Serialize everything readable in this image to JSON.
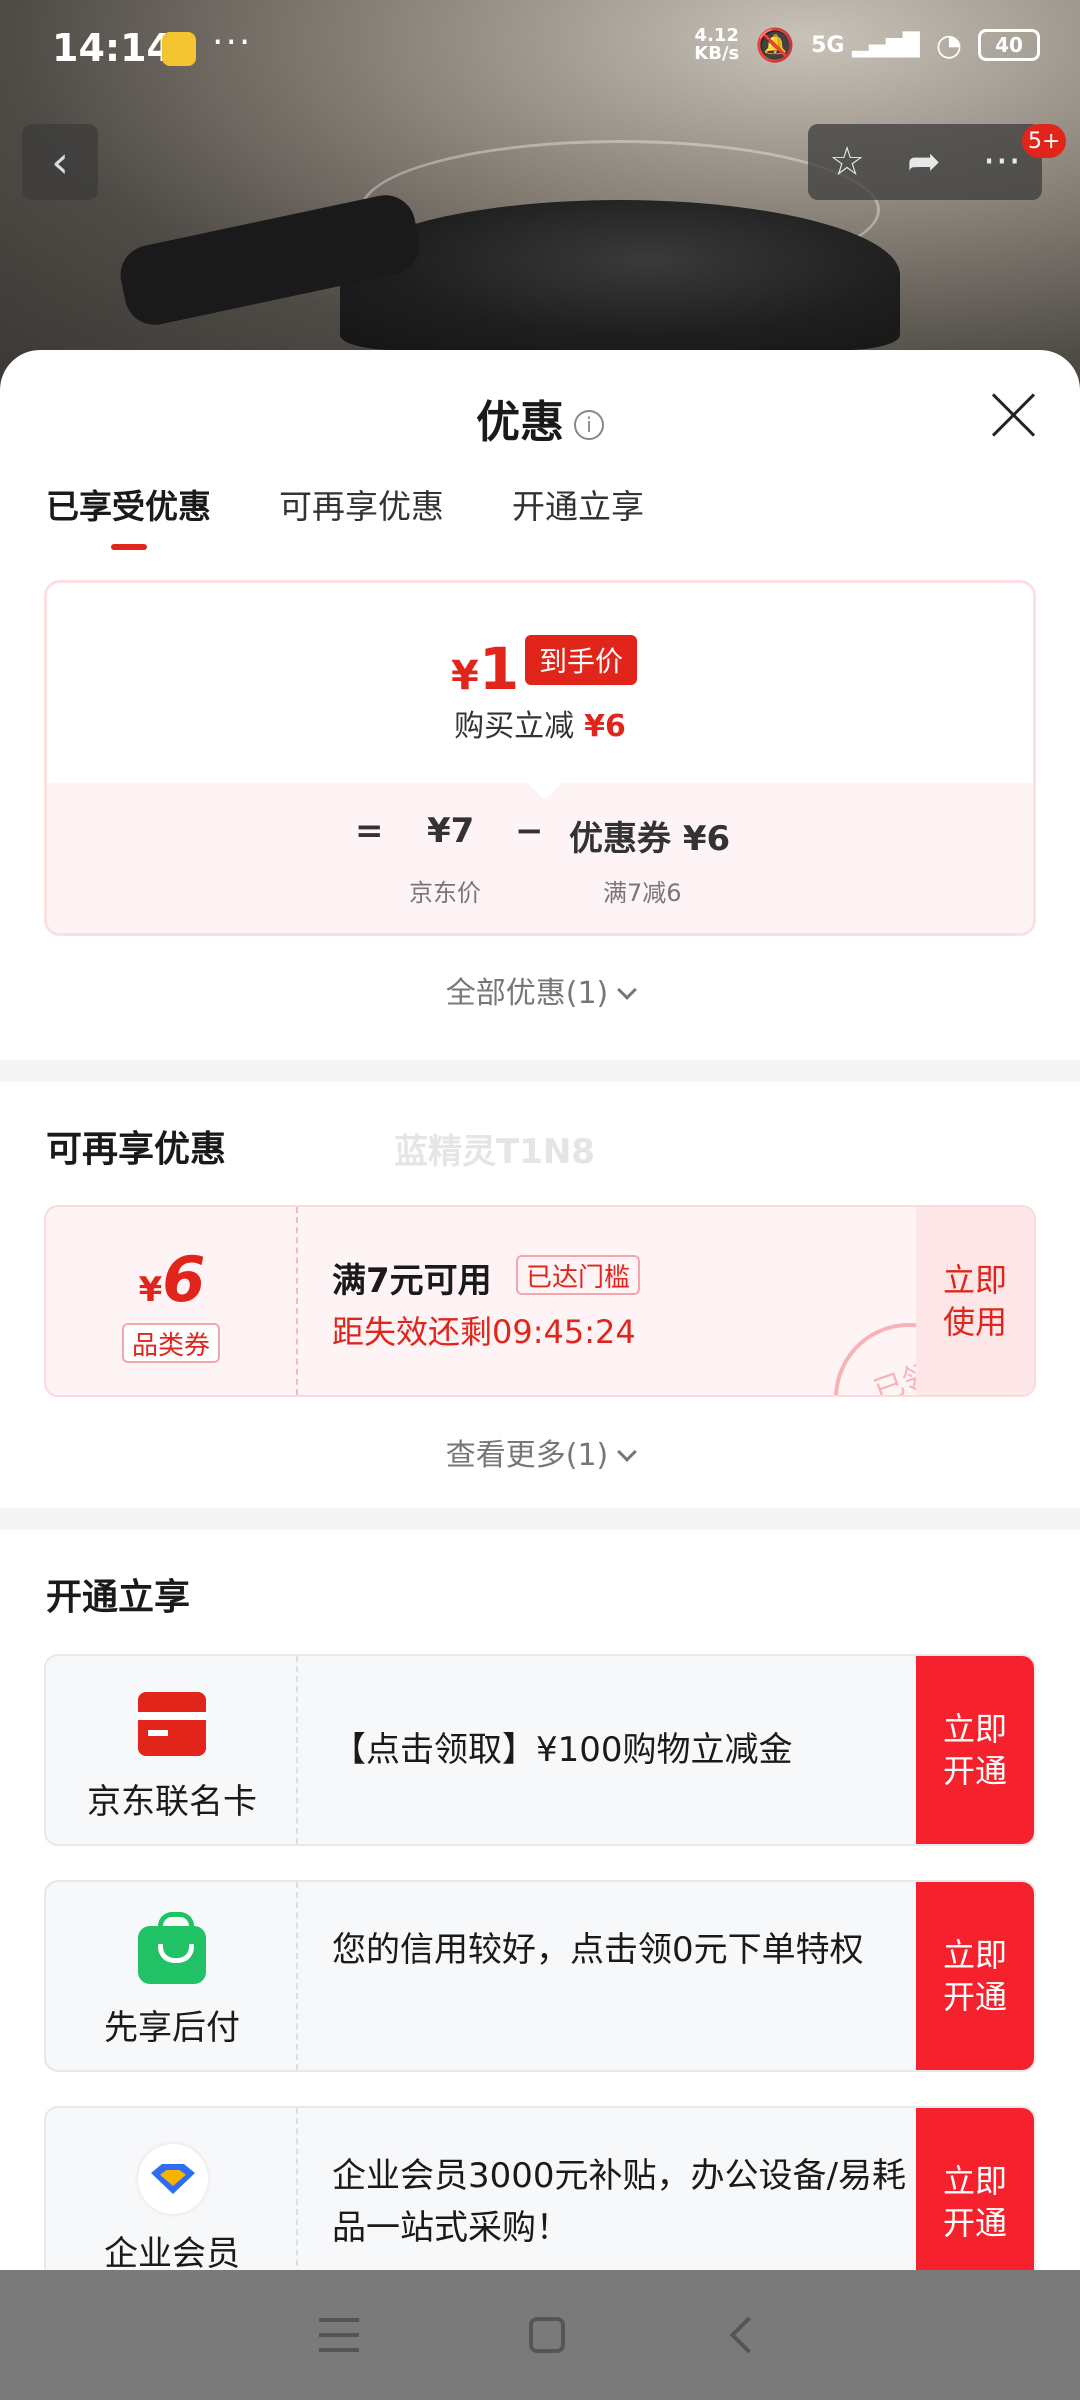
{
  "status_bar": {
    "time": "14:14",
    "net_speed_top": "4.12",
    "net_speed_bottom": "KB/s",
    "signal_label": "5G",
    "battery": "40"
  },
  "nav": {
    "badge": "5+"
  },
  "sheet": {
    "title": "优惠",
    "info_icon": "i",
    "tabs": [
      "已享受优惠",
      "可再享优惠",
      "开通立享"
    ],
    "price": {
      "currency": "¥",
      "final": "1",
      "tag": "到手价",
      "reduce_label": "购买立减",
      "reduce_value": "¥6",
      "eq": "=",
      "jd_price": "¥7",
      "minus": "−",
      "coupon_label": "优惠券 ¥6",
      "jd_price_caption": "京东价",
      "coupon_caption": "满7减6"
    },
    "all_offers": "全部优惠(1)"
  },
  "reenjoy": {
    "title": "可再享优惠",
    "watermark": "蓝精灵T1N8",
    "coupon": {
      "currency": "¥",
      "amount": "6",
      "type": "品类券",
      "condition": "满7元可用",
      "condition_tag": "已达门槛",
      "countdown": "距失效还剩09:45:24",
      "action_line1": "立即",
      "action_line2": "使用",
      "stamp": "已领"
    },
    "see_more": "查看更多(1)"
  },
  "open": {
    "title": "开通立享",
    "items": [
      {
        "name": "京东联名卡",
        "desc": "【点击领取】¥100购物立减金",
        "btn1": "立即",
        "btn2": "开通"
      },
      {
        "name": "先享后付",
        "desc": "您的信用较好，点击领0元下单特权",
        "btn1": "立即",
        "btn2": "开通"
      },
      {
        "name": "企业会员",
        "desc": "企业会员3000元补贴，办公设备/易耗品一站式采购！",
        "btn1": "立即",
        "btn2": "开通"
      }
    ]
  },
  "colors": {
    "accent": "#e1251b",
    "button_red": "#f5222d",
    "green": "#21c266"
  }
}
